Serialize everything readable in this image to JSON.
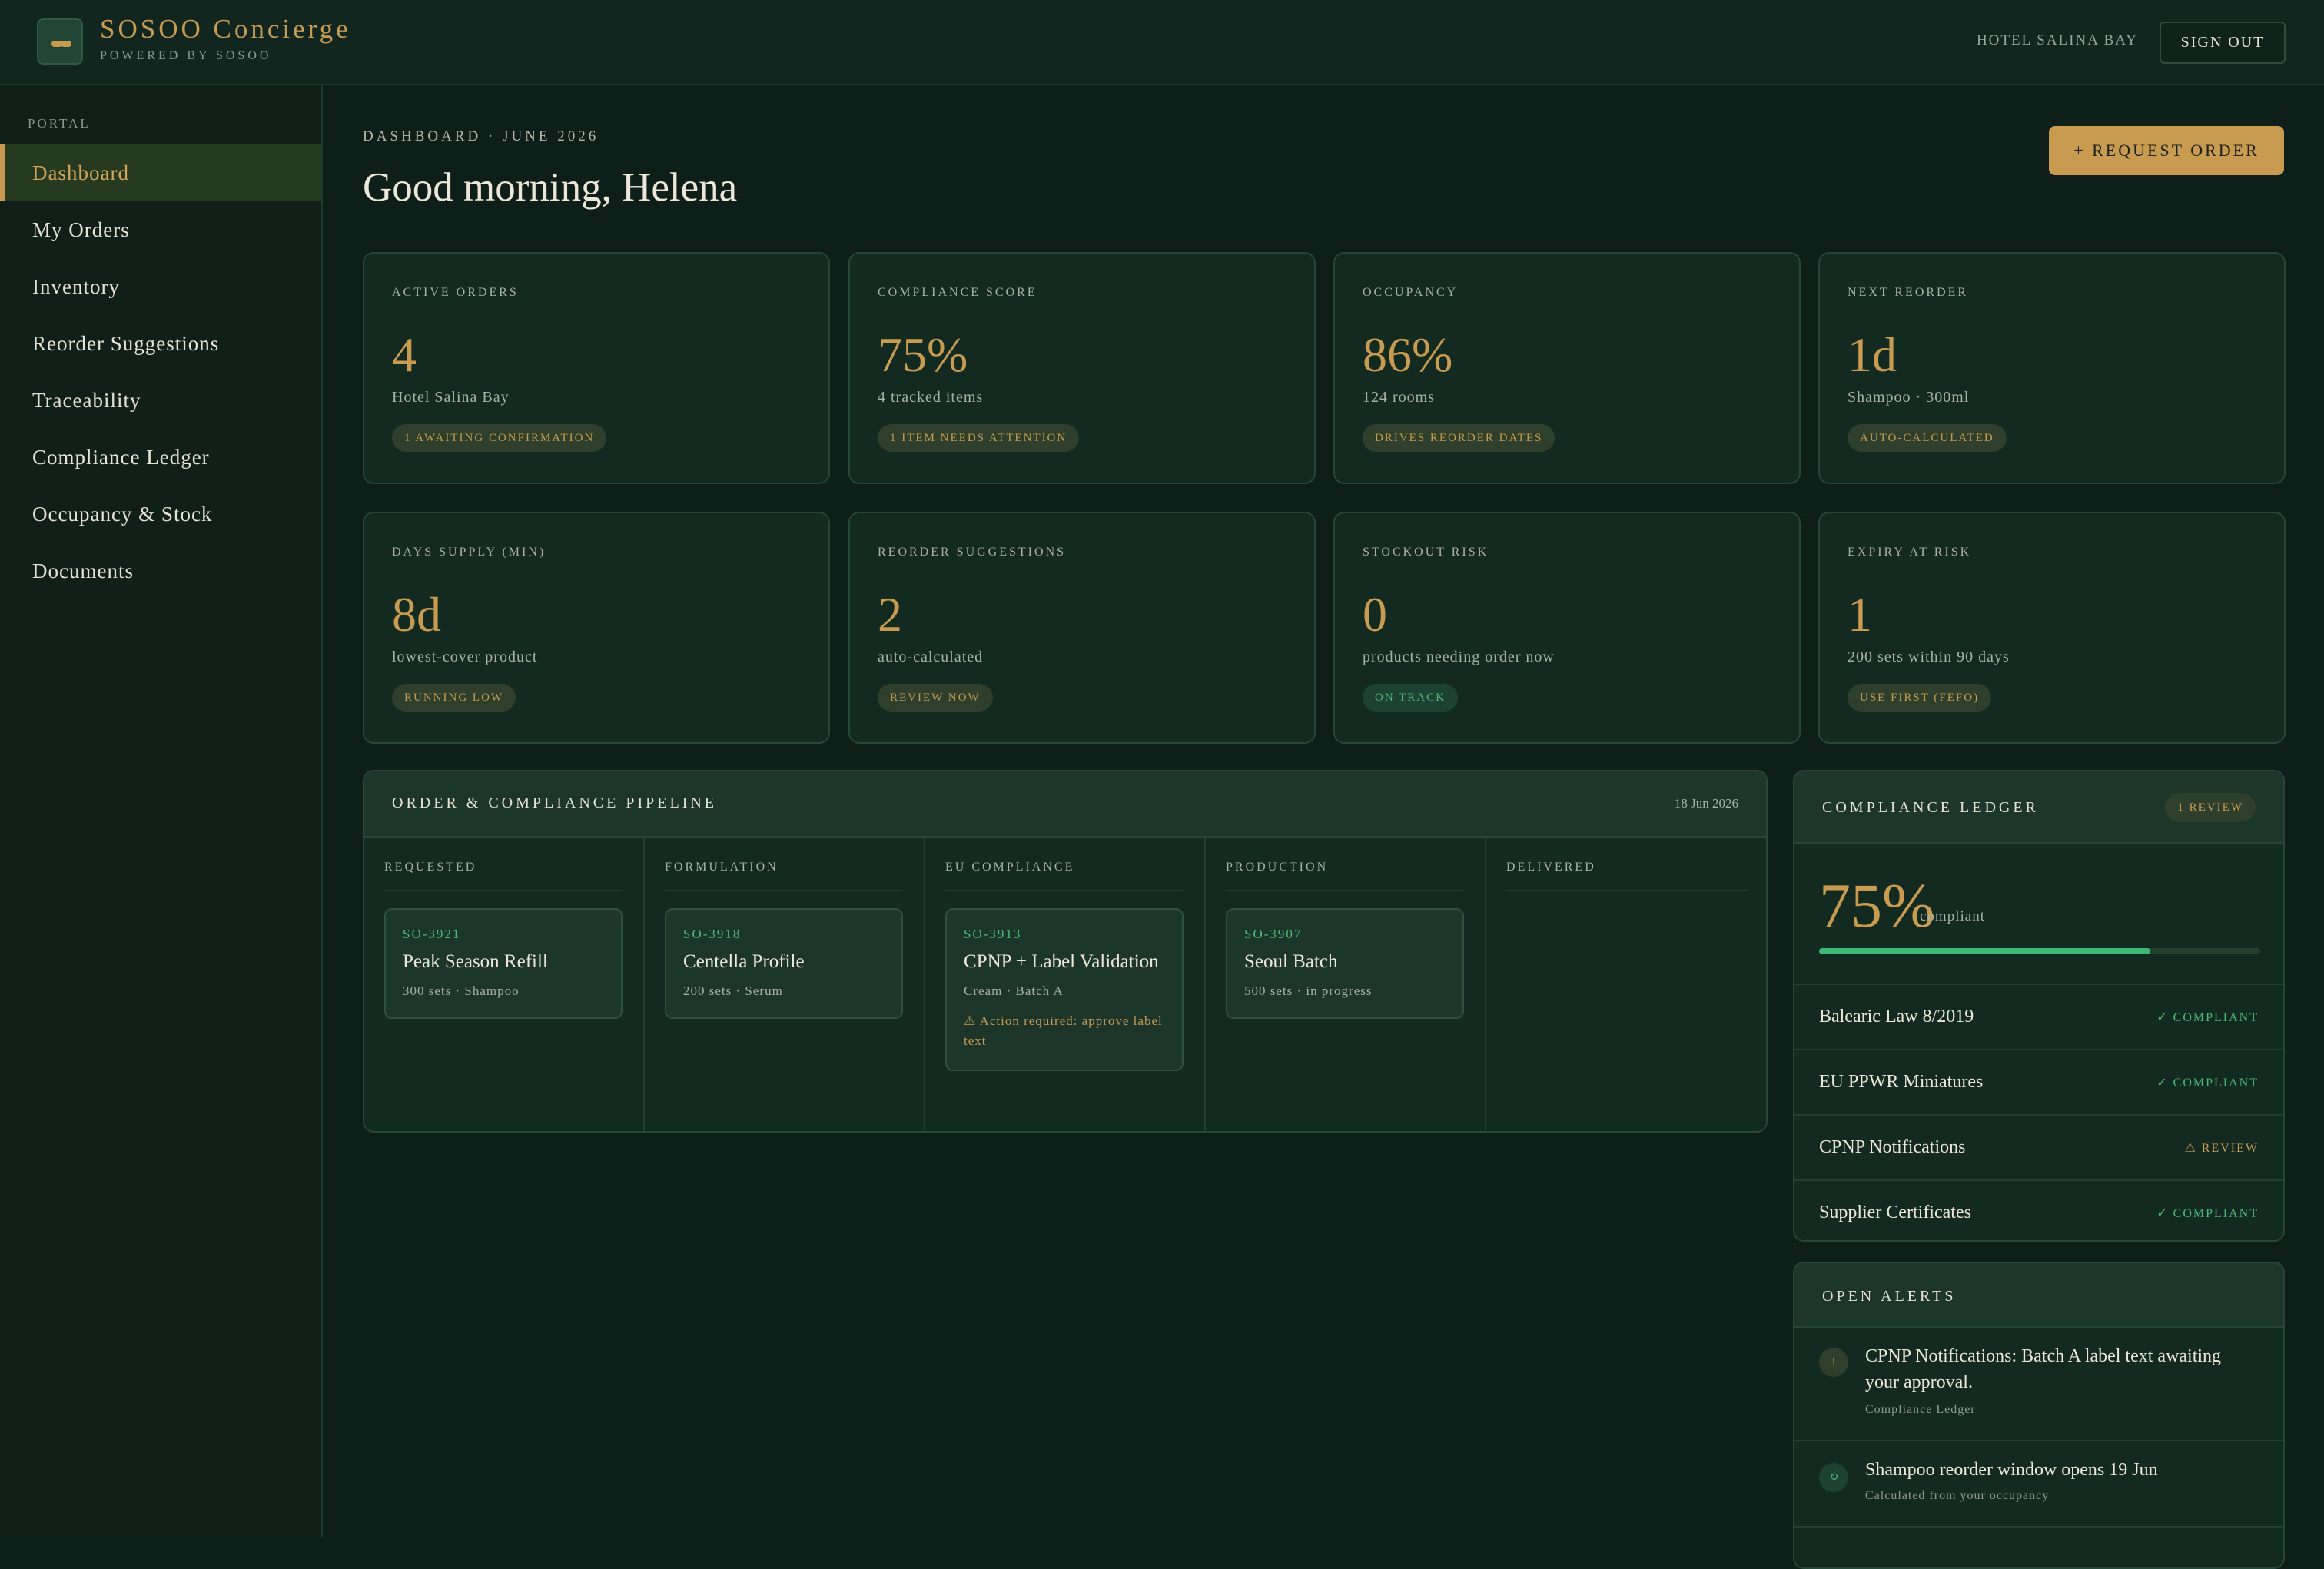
{
  "brand": {
    "title": "SOSOO Concierge",
    "subtitle": "POWERED BY SOSOO"
  },
  "header": {
    "hotel": "HOTEL SALINA BAY",
    "signout_label": "SIGN OUT"
  },
  "sidebar": {
    "section_label": "PORTAL",
    "items": [
      {
        "label": "Dashboard",
        "active": true
      },
      {
        "label": "My Orders"
      },
      {
        "label": "Inventory"
      },
      {
        "label": "Reorder Suggestions"
      },
      {
        "label": "Traceability"
      },
      {
        "label": "Compliance Ledger"
      },
      {
        "label": "Occupancy & Stock"
      },
      {
        "label": "Documents"
      }
    ]
  },
  "main": {
    "breadcrumb": "DASHBOARD · JUNE 2026",
    "greeting": "Good morning, Helena",
    "request_label": "+ REQUEST ORDER"
  },
  "stats": [
    {
      "label": "ACTIVE ORDERS",
      "value": "4",
      "sub": "Hotel Salina Bay",
      "badge": "1 AWAITING CONFIRMATION",
      "badge_tone": "gold"
    },
    {
      "label": "COMPLIANCE SCORE",
      "value": "75%",
      "sub": "4 tracked items",
      "badge": "1 ITEM NEEDS ATTENTION",
      "badge_tone": "gold"
    },
    {
      "label": "OCCUPANCY",
      "value": "86%",
      "sub": "124 rooms",
      "badge": "DRIVES REORDER DATES",
      "badge_tone": "gold"
    },
    {
      "label": "NEXT REORDER",
      "value": "1d",
      "sub": "Shampoo · 300ml",
      "badge": "AUTO-CALCULATED",
      "badge_tone": "gold"
    },
    {
      "label": "DAYS SUPPLY (MIN)",
      "value": "8d",
      "sub": "lowest-cover product",
      "badge": "RUNNING LOW",
      "badge_tone": "gold"
    },
    {
      "label": "REORDER SUGGESTIONS",
      "value": "2",
      "sub": "auto-calculated",
      "badge": "REVIEW NOW",
      "badge_tone": "gold"
    },
    {
      "label": "STOCKOUT RISK",
      "value": "0",
      "sub": "products needing order now",
      "badge": "ON TRACK",
      "badge_tone": "green"
    },
    {
      "label": "EXPIRY AT RISK",
      "value": "1",
      "sub": "200 sets within 90 days",
      "badge": "USE FIRST (FEFO)",
      "badge_tone": "gold"
    }
  ],
  "pipeline": {
    "title": "ORDER & COMPLIANCE PIPELINE",
    "date": "18 Jun 2026",
    "columns": [
      {
        "label": "REQUESTED",
        "order": {
          "id": "SO-3921",
          "name": "Peak Season Refill",
          "meta": "300 sets · Shampoo"
        }
      },
      {
        "label": "FORMULATION",
        "order": {
          "id": "SO-3918",
          "name": "Centella Profile",
          "meta": "200 sets · Serum"
        }
      },
      {
        "label": "EU COMPLIANCE",
        "order": {
          "id": "SO-3913",
          "name": "CPNP + Label Validation",
          "meta": "Cream · Batch A",
          "warning": "⚠ Action required: approve label text"
        }
      },
      {
        "label": "PRODUCTION",
        "order": {
          "id": "SO-3907",
          "name": "Seoul Batch",
          "meta": "500 sets · in progress"
        }
      },
      {
        "label": "DELIVERED"
      }
    ]
  },
  "ledger": {
    "title": "COMPLIANCE LEDGER",
    "badge": "1 REVIEW",
    "score": "75%",
    "score_fraction": 0.75,
    "score_label": "compliant",
    "rows": [
      {
        "name": "Balearic Law 8/2019",
        "status": "✓ COMPLIANT",
        "tone": "ok"
      },
      {
        "name": "EU PPWR Miniatures",
        "status": "✓ COMPLIANT",
        "tone": "ok"
      },
      {
        "name": "CPNP Notifications",
        "status": "⚠ REVIEW",
        "tone": "review"
      },
      {
        "name": "Supplier Certificates",
        "status": "✓ COMPLIANT",
        "tone": "ok"
      }
    ]
  },
  "alerts": {
    "title": "OPEN ALERTS",
    "items": [
      {
        "icon": "exclamation-icon",
        "glyph": "!",
        "tone": "warn",
        "text": "CPNP Notifications: Batch A label text awaiting your approval.",
        "sub": "Compliance Ledger"
      },
      {
        "icon": "refresh-icon",
        "glyph": "↻",
        "tone": "info",
        "text": "Shampoo reorder window opens 19 Jun",
        "sub": "Calculated from your occupancy"
      }
    ]
  },
  "colors": {
    "background": "#0e1e18",
    "accent_gold": "#c89b50",
    "status_green": "#4fb97a",
    "card": "#132a21"
  }
}
